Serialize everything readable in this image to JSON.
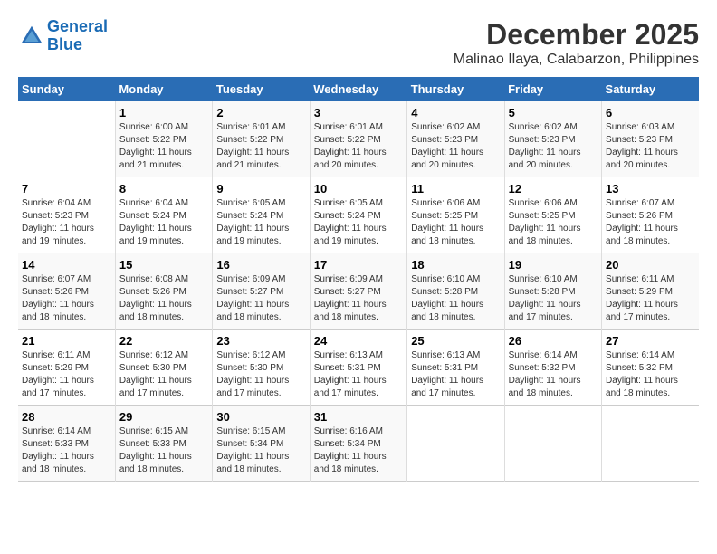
{
  "logo": {
    "line1": "General",
    "line2": "Blue"
  },
  "title": "December 2025",
  "subtitle": "Malinao Ilaya, Calabarzon, Philippines",
  "header": {
    "days": [
      "Sunday",
      "Monday",
      "Tuesday",
      "Wednesday",
      "Thursday",
      "Friday",
      "Saturday"
    ]
  },
  "weeks": [
    {
      "cells": [
        {
          "day": "",
          "info": ""
        },
        {
          "day": "1",
          "info": "Sunrise: 6:00 AM\nSunset: 5:22 PM\nDaylight: 11 hours\nand 21 minutes."
        },
        {
          "day": "2",
          "info": "Sunrise: 6:01 AM\nSunset: 5:22 PM\nDaylight: 11 hours\nand 21 minutes."
        },
        {
          "day": "3",
          "info": "Sunrise: 6:01 AM\nSunset: 5:22 PM\nDaylight: 11 hours\nand 20 minutes."
        },
        {
          "day": "4",
          "info": "Sunrise: 6:02 AM\nSunset: 5:23 PM\nDaylight: 11 hours\nand 20 minutes."
        },
        {
          "day": "5",
          "info": "Sunrise: 6:02 AM\nSunset: 5:23 PM\nDaylight: 11 hours\nand 20 minutes."
        },
        {
          "day": "6",
          "info": "Sunrise: 6:03 AM\nSunset: 5:23 PM\nDaylight: 11 hours\nand 20 minutes."
        }
      ]
    },
    {
      "cells": [
        {
          "day": "7",
          "info": "Sunrise: 6:04 AM\nSunset: 5:23 PM\nDaylight: 11 hours\nand 19 minutes."
        },
        {
          "day": "8",
          "info": "Sunrise: 6:04 AM\nSunset: 5:24 PM\nDaylight: 11 hours\nand 19 minutes."
        },
        {
          "day": "9",
          "info": "Sunrise: 6:05 AM\nSunset: 5:24 PM\nDaylight: 11 hours\nand 19 minutes."
        },
        {
          "day": "10",
          "info": "Sunrise: 6:05 AM\nSunset: 5:24 PM\nDaylight: 11 hours\nand 19 minutes."
        },
        {
          "day": "11",
          "info": "Sunrise: 6:06 AM\nSunset: 5:25 PM\nDaylight: 11 hours\nand 18 minutes."
        },
        {
          "day": "12",
          "info": "Sunrise: 6:06 AM\nSunset: 5:25 PM\nDaylight: 11 hours\nand 18 minutes."
        },
        {
          "day": "13",
          "info": "Sunrise: 6:07 AM\nSunset: 5:26 PM\nDaylight: 11 hours\nand 18 minutes."
        }
      ]
    },
    {
      "cells": [
        {
          "day": "14",
          "info": "Sunrise: 6:07 AM\nSunset: 5:26 PM\nDaylight: 11 hours\nand 18 minutes."
        },
        {
          "day": "15",
          "info": "Sunrise: 6:08 AM\nSunset: 5:26 PM\nDaylight: 11 hours\nand 18 minutes."
        },
        {
          "day": "16",
          "info": "Sunrise: 6:09 AM\nSunset: 5:27 PM\nDaylight: 11 hours\nand 18 minutes."
        },
        {
          "day": "17",
          "info": "Sunrise: 6:09 AM\nSunset: 5:27 PM\nDaylight: 11 hours\nand 18 minutes."
        },
        {
          "day": "18",
          "info": "Sunrise: 6:10 AM\nSunset: 5:28 PM\nDaylight: 11 hours\nand 18 minutes."
        },
        {
          "day": "19",
          "info": "Sunrise: 6:10 AM\nSunset: 5:28 PM\nDaylight: 11 hours\nand 17 minutes."
        },
        {
          "day": "20",
          "info": "Sunrise: 6:11 AM\nSunset: 5:29 PM\nDaylight: 11 hours\nand 17 minutes."
        }
      ]
    },
    {
      "cells": [
        {
          "day": "21",
          "info": "Sunrise: 6:11 AM\nSunset: 5:29 PM\nDaylight: 11 hours\nand 17 minutes."
        },
        {
          "day": "22",
          "info": "Sunrise: 6:12 AM\nSunset: 5:30 PM\nDaylight: 11 hours\nand 17 minutes."
        },
        {
          "day": "23",
          "info": "Sunrise: 6:12 AM\nSunset: 5:30 PM\nDaylight: 11 hours\nand 17 minutes."
        },
        {
          "day": "24",
          "info": "Sunrise: 6:13 AM\nSunset: 5:31 PM\nDaylight: 11 hours\nand 17 minutes."
        },
        {
          "day": "25",
          "info": "Sunrise: 6:13 AM\nSunset: 5:31 PM\nDaylight: 11 hours\nand 17 minutes."
        },
        {
          "day": "26",
          "info": "Sunrise: 6:14 AM\nSunset: 5:32 PM\nDaylight: 11 hours\nand 18 minutes."
        },
        {
          "day": "27",
          "info": "Sunrise: 6:14 AM\nSunset: 5:32 PM\nDaylight: 11 hours\nand 18 minutes."
        }
      ]
    },
    {
      "cells": [
        {
          "day": "28",
          "info": "Sunrise: 6:14 AM\nSunset: 5:33 PM\nDaylight: 11 hours\nand 18 minutes."
        },
        {
          "day": "29",
          "info": "Sunrise: 6:15 AM\nSunset: 5:33 PM\nDaylight: 11 hours\nand 18 minutes."
        },
        {
          "day": "30",
          "info": "Sunrise: 6:15 AM\nSunset: 5:34 PM\nDaylight: 11 hours\nand 18 minutes."
        },
        {
          "day": "31",
          "info": "Sunrise: 6:16 AM\nSunset: 5:34 PM\nDaylight: 11 hours\nand 18 minutes."
        },
        {
          "day": "",
          "info": ""
        },
        {
          "day": "",
          "info": ""
        },
        {
          "day": "",
          "info": ""
        }
      ]
    }
  ]
}
